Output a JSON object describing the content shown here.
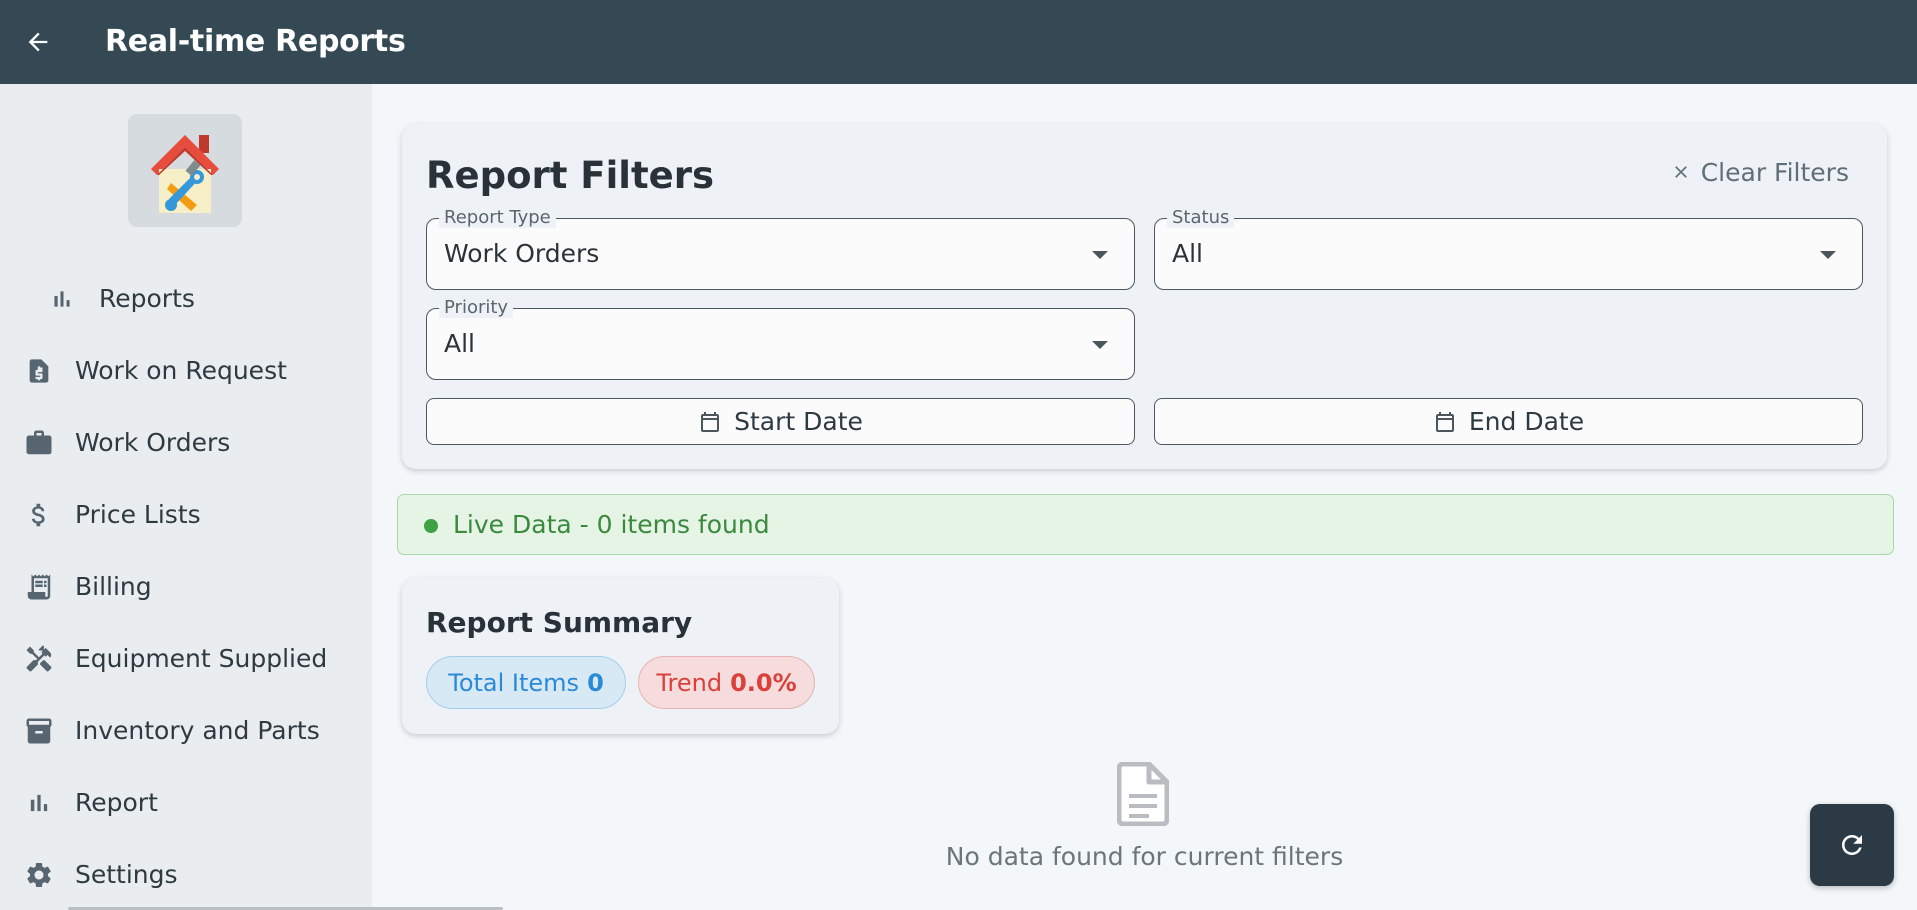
{
  "appbar": {
    "title": "Real-time Reports"
  },
  "sidebar": {
    "items": [
      {
        "label": "Reports",
        "icon": "bar-chart-icon"
      },
      {
        "label": "Work on Request",
        "icon": "invoice-document-icon"
      },
      {
        "label": "Work Orders",
        "icon": "briefcase-icon"
      },
      {
        "label": "Price Lists",
        "icon": "dollar-icon"
      },
      {
        "label": "Billing",
        "icon": "receipt-icon"
      },
      {
        "label": "Equipment Supplied",
        "icon": "tools-icon"
      },
      {
        "label": "Inventory and Parts",
        "icon": "archive-box-icon"
      },
      {
        "label": "Report",
        "icon": "bar-chart-icon"
      },
      {
        "label": "Settings",
        "icon": "gear-icon"
      }
    ]
  },
  "filters": {
    "title": "Report Filters",
    "clear_label": "Clear Filters",
    "report_type": {
      "label": "Report Type",
      "value": "Work Orders"
    },
    "status": {
      "label": "Status",
      "value": "All"
    },
    "priority": {
      "label": "Priority",
      "value": "All"
    },
    "start_date_label": "Start Date",
    "end_date_label": "End Date"
  },
  "live": {
    "text": "Live Data - 0 items found",
    "color": "#3da245"
  },
  "summary": {
    "title": "Report Summary",
    "total_label": "Total Items",
    "total_value": "0",
    "trend_label": "Trend",
    "trend_value": "0.0%"
  },
  "empty": {
    "text": "No data found for current filters"
  },
  "colors": {
    "appbar": "#354955",
    "sidebar": "#eaedf0",
    "accent_blue": "#2b8ad6",
    "accent_red": "#d9413a",
    "success": "#3da245"
  }
}
